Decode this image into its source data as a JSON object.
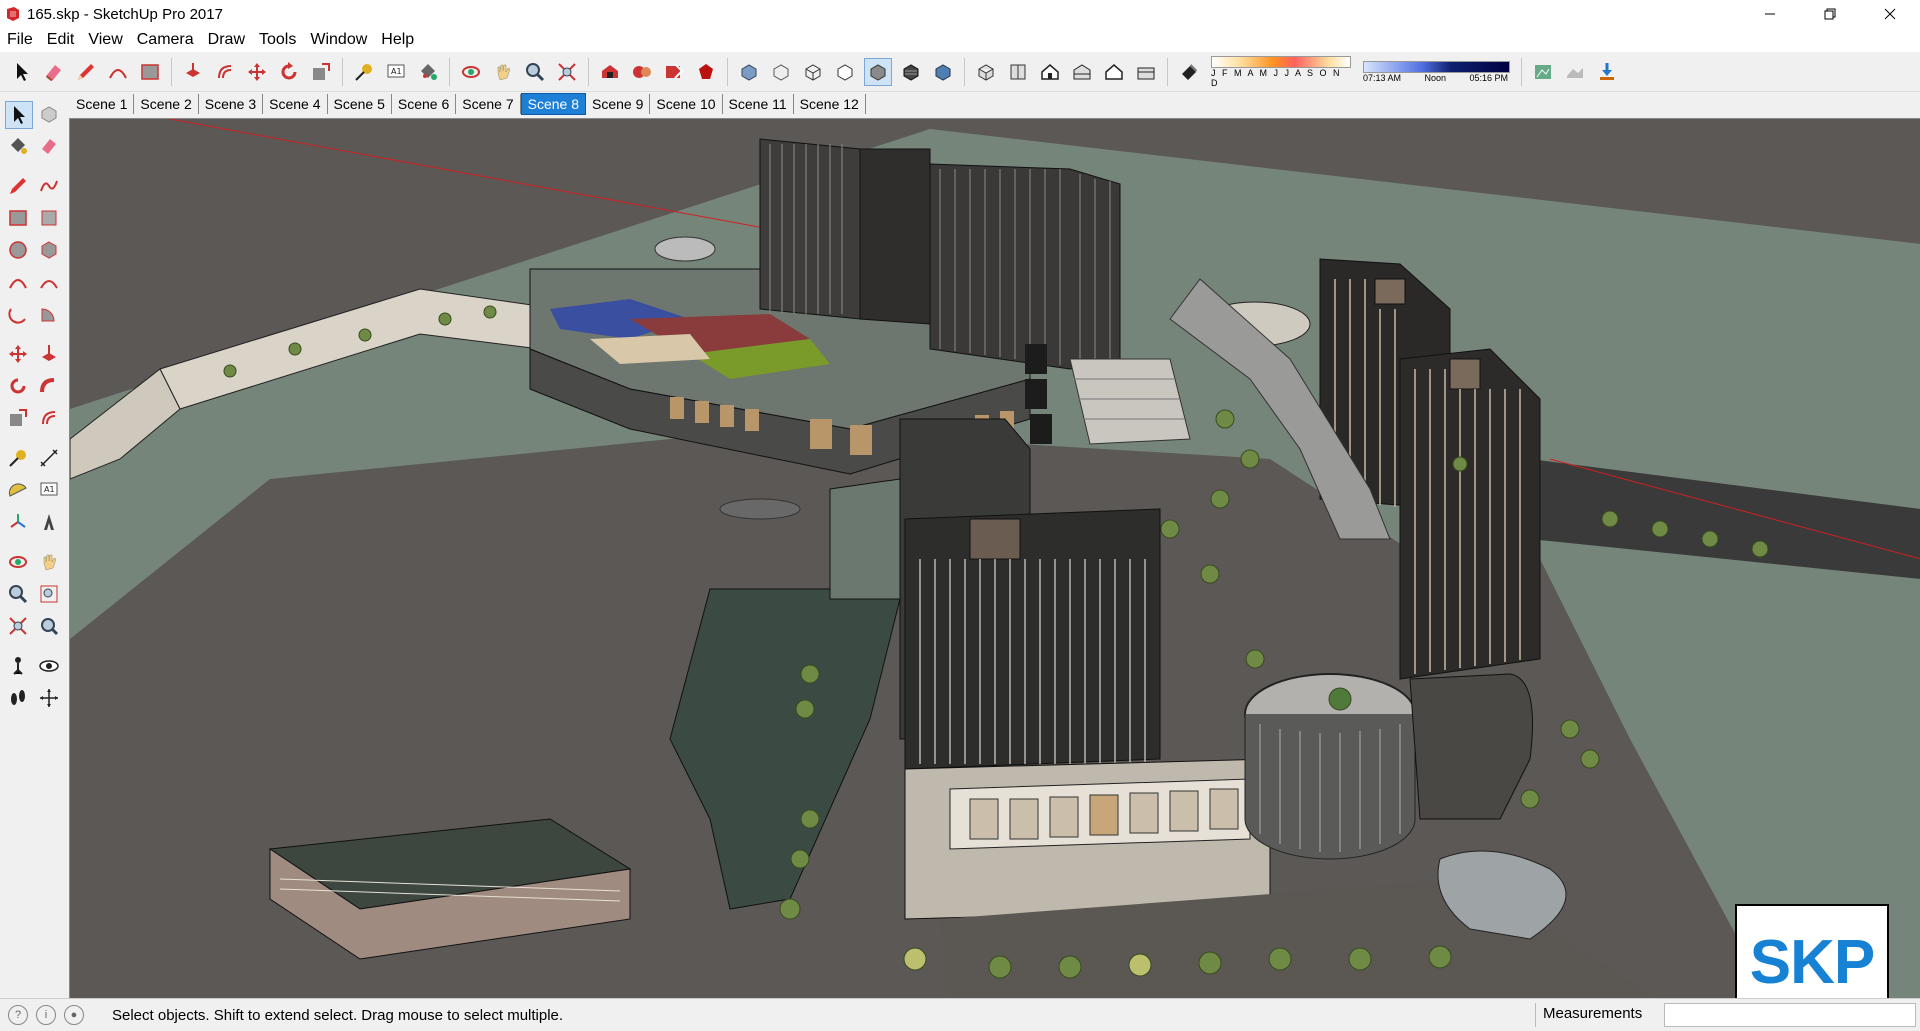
{
  "window": {
    "title": "165.skp - SketchUp Pro 2017"
  },
  "menu": [
    "File",
    "Edit",
    "View",
    "Camera",
    "Draw",
    "Tools",
    "Window",
    "Help"
  ],
  "shadow": {
    "months": "J F M A M J J A S O N D",
    "time_start": "07:13 AM",
    "time_mid": "Noon",
    "time_end": "05:16 PM"
  },
  "scenes": [
    "Scene 1",
    "Scene 2",
    "Scene 3",
    "Scene 4",
    "Scene 5",
    "Scene 6",
    "Scene 7",
    "Scene 8",
    "Scene 9",
    "Scene 10",
    "Scene 11",
    "Scene 12"
  ],
  "active_scene": "Scene 8",
  "status": {
    "message": "Select objects. Shift to extend select. Drag mouse to select multiple.",
    "measurements_label": "Measurements",
    "measurements_value": ""
  },
  "badge": {
    "text": "SKP"
  },
  "colors": {
    "accent": "#1e7fd6",
    "skp_blue": "#1782d4",
    "ground": "#5a5753",
    "lawn": "#76857a"
  }
}
